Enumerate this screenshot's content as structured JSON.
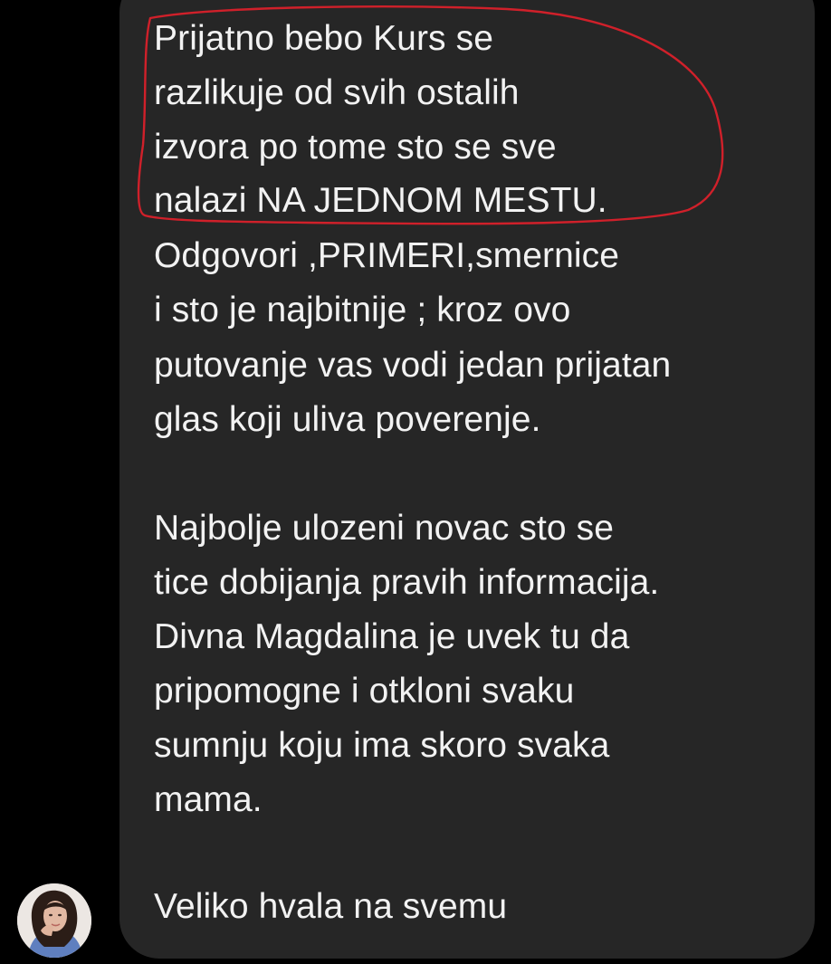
{
  "message": {
    "lines": [
      "Prijatno bebo Kurs se",
      "razlikuje od svih ostalih",
      "izvora po tome sto se sve",
      "nalazi NA JEDNOM MESTU.",
      "Odgovori ,PRIMERI,smernice",
      "i sto je najbitnije ; kroz ovo",
      "putovanje vas vodi jedan prijatan",
      "glas koji uliva poverenje.",
      "",
      "Najbolje ulozeni novac sto se",
      "tice dobijanja pravih informacija.",
      "Divna Magdalina je uvek tu da",
      "pripomogne i otkloni svaku",
      "sumnju koju ima skoro svaka",
      "mama.",
      "",
      "Veliko hvala na svemu"
    ]
  },
  "colors": {
    "background": "#000000",
    "bubble": "#262626",
    "text": "#f2f2f2",
    "annotation": "#d0202a"
  },
  "icons": {
    "sender_avatar": "avatar-photo"
  }
}
